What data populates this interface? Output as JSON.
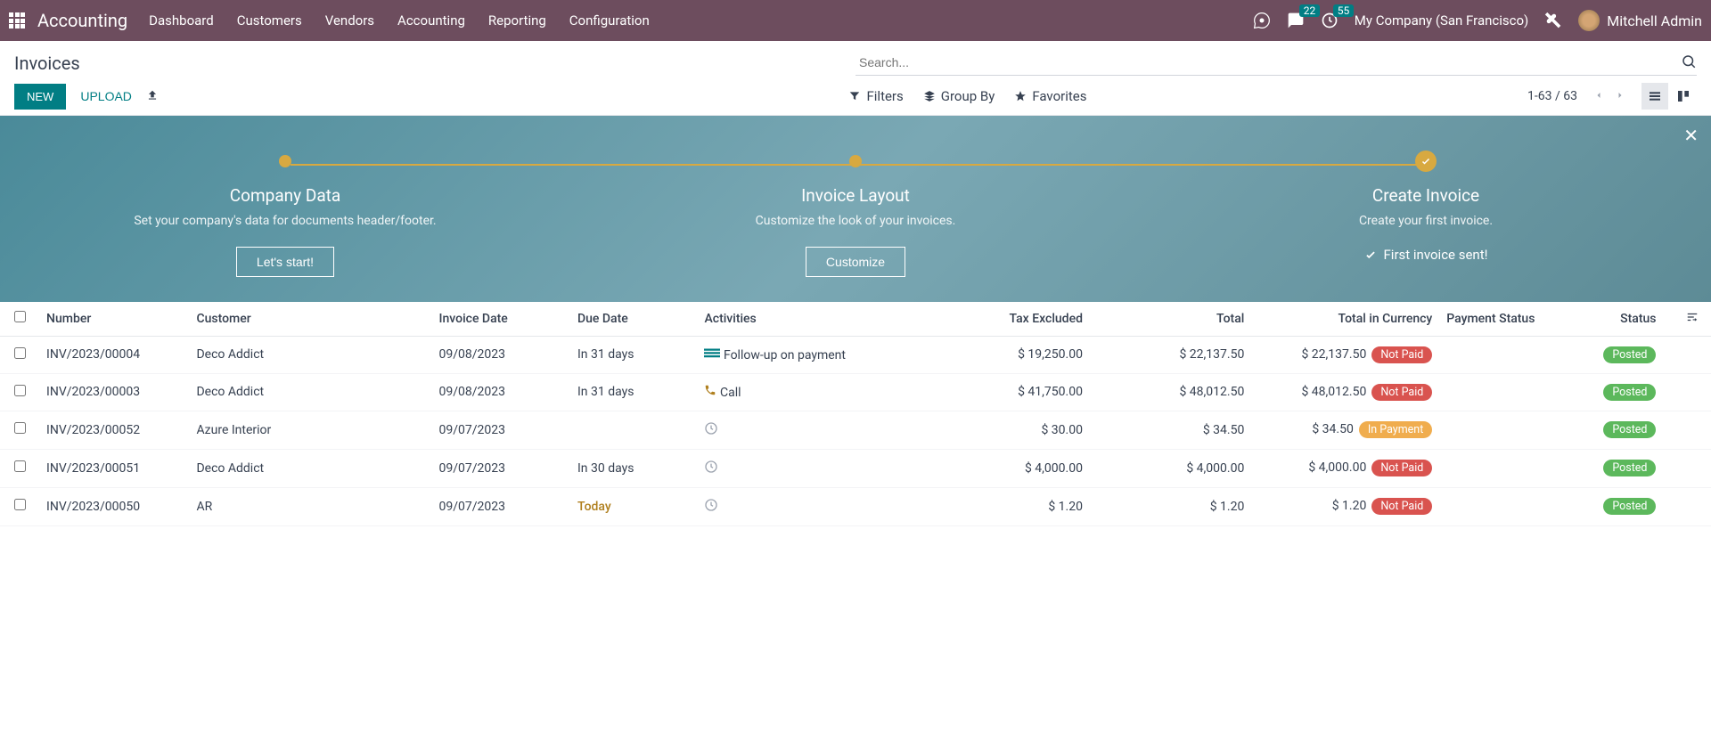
{
  "nav": {
    "brand": "Accounting",
    "links": [
      "Dashboard",
      "Customers",
      "Vendors",
      "Accounting",
      "Reporting",
      "Configuration"
    ],
    "messages_badge": "22",
    "activities_badge": "55",
    "company": "My Company (San Francisco)",
    "user": "Mitchell Admin"
  },
  "breadcrumb": "Invoices",
  "buttons": {
    "new": "NEW",
    "upload": "UPLOAD"
  },
  "search": {
    "placeholder": "Search..."
  },
  "filters": {
    "filters": "Filters",
    "group_by": "Group By",
    "favorites": "Favorites"
  },
  "pager": "1-63 / 63",
  "onboard": {
    "steps": [
      {
        "title": "Company Data",
        "desc": "Set your company's data for documents header/footer.",
        "btn": "Let's start!",
        "done": false
      },
      {
        "title": "Invoice Layout",
        "desc": "Customize the look of your invoices.",
        "btn": "Customize",
        "done": false
      },
      {
        "title": "Create Invoice",
        "desc": "Create your first invoice.",
        "btn": "First invoice sent!",
        "done": true
      }
    ]
  },
  "columns": {
    "number": "Number",
    "customer": "Customer",
    "invoice_date": "Invoice Date",
    "due_date": "Due Date",
    "activities": "Activities",
    "tax_excluded": "Tax Excluded",
    "total": "Total",
    "total_currency": "Total in Currency",
    "payment_status": "Payment Status",
    "status": "Status"
  },
  "rows": [
    {
      "number": "INV/2023/00004",
      "customer": "Deco Addict",
      "date": "09/08/2023",
      "due": "In 31 days",
      "due_today": false,
      "activity": {
        "icon": "list",
        "label": "Follow-up on payment"
      },
      "tax": "$ 19,250.00",
      "total": "$ 22,137.50",
      "tic": "$ 22,137.50",
      "pay": "Not Paid",
      "pay_color": "red",
      "status": "Posted"
    },
    {
      "number": "INV/2023/00003",
      "customer": "Deco Addict",
      "date": "09/08/2023",
      "due": "In 31 days",
      "due_today": false,
      "activity": {
        "icon": "phone",
        "label": "Call"
      },
      "tax": "$ 41,750.00",
      "total": "$ 48,012.50",
      "tic": "$ 48,012.50",
      "pay": "Not Paid",
      "pay_color": "red",
      "status": "Posted"
    },
    {
      "number": "INV/2023/00052",
      "customer": "Azure Interior",
      "date": "09/07/2023",
      "due": "",
      "due_today": false,
      "activity": {
        "icon": "clock",
        "label": ""
      },
      "tax": "$ 30.00",
      "total": "$ 34.50",
      "tic": "$ 34.50",
      "pay": "In Payment",
      "pay_color": "orange",
      "status": "Posted"
    },
    {
      "number": "INV/2023/00051",
      "customer": "Deco Addict",
      "date": "09/07/2023",
      "due": "In 30 days",
      "due_today": false,
      "activity": {
        "icon": "clock",
        "label": ""
      },
      "tax": "$ 4,000.00",
      "total": "$ 4,000.00",
      "tic": "$ 4,000.00",
      "pay": "Not Paid",
      "pay_color": "red",
      "status": "Posted"
    },
    {
      "number": "INV/2023/00050",
      "customer": "AR",
      "date": "09/07/2023",
      "due": "Today",
      "due_today": true,
      "activity": {
        "icon": "clock",
        "label": ""
      },
      "tax": "$ 1.20",
      "total": "$ 1.20",
      "tic": "$ 1.20",
      "pay": "Not Paid",
      "pay_color": "red",
      "status": "Posted"
    }
  ]
}
